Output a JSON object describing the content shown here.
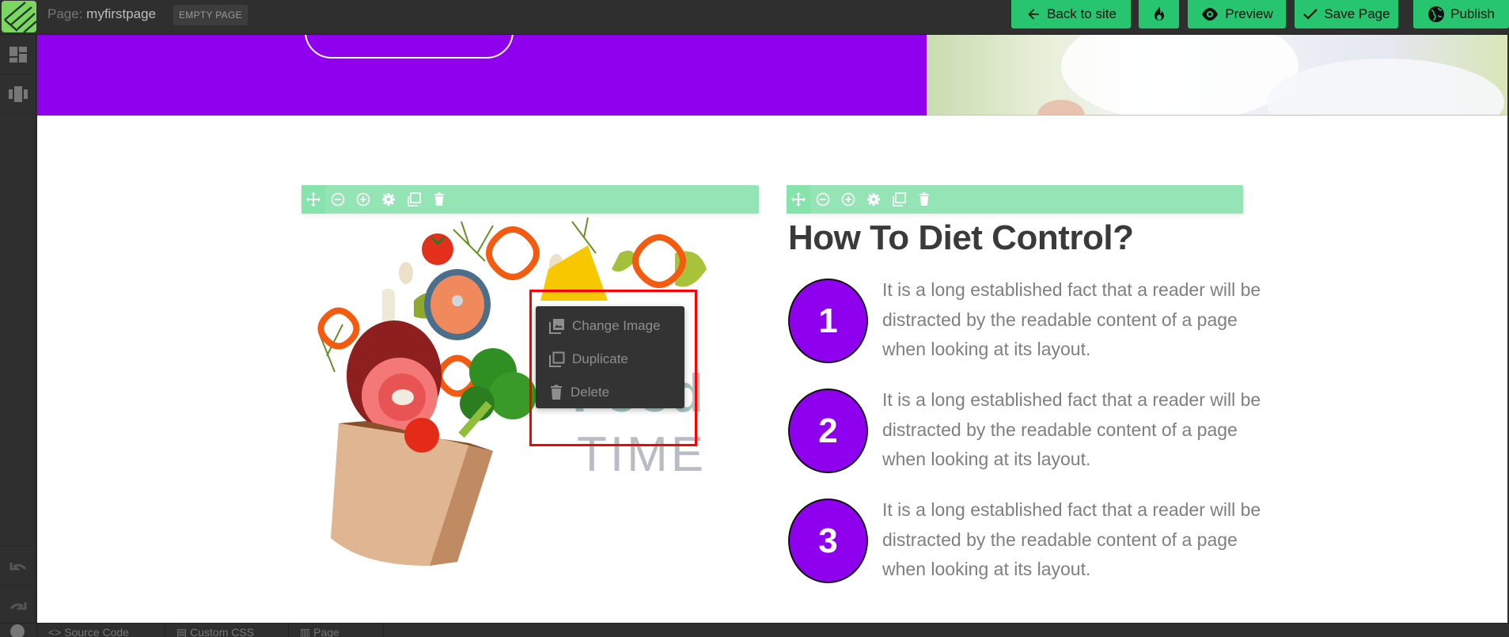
{
  "topbar": {
    "page_prefix": "Page:",
    "page_name": "myfirstpage",
    "badge": "EMPTY PAGE",
    "buttons": {
      "back": "Back to site",
      "preview": "Preview",
      "save": "Save Page",
      "publish": "Publish"
    }
  },
  "sidebar": {
    "items": [
      "blocks-icon",
      "components-icon"
    ],
    "bottom": [
      "undo-icon",
      "redo-icon"
    ]
  },
  "content": {
    "heading": "How To Diet Control?",
    "steps": [
      {
        "number": "1",
        "text": "It is a long established fact that a reader will be distracted by the readable content of a page when looking at its layout."
      },
      {
        "number": "2",
        "text": "It is a long established fact that a reader will be distracted by the readable content of a page when looking at its layout."
      },
      {
        "number": "3",
        "text": "It is a long established fact that a reader will be distracted by the readable content of a page when looking at its layout."
      }
    ],
    "illustration": {
      "title_line1": "Food",
      "title_line2": "TIME"
    }
  },
  "block_toolbar": {
    "icons": [
      "move-icon",
      "zoom-out-icon",
      "zoom-in-icon",
      "settings-icon",
      "duplicate-icon",
      "delete-icon"
    ]
  },
  "context_menu": {
    "items": [
      "Change Image",
      "Duplicate",
      "Delete"
    ]
  },
  "bottombar": {
    "items": [
      "Source Code",
      "Custom CSS",
      "Page"
    ]
  },
  "colors": {
    "accent_green": "#27c56f",
    "toolbar_green": "#94e4b6",
    "brand_purple": "#8f00ef",
    "highlight_red": "#ff0000"
  }
}
